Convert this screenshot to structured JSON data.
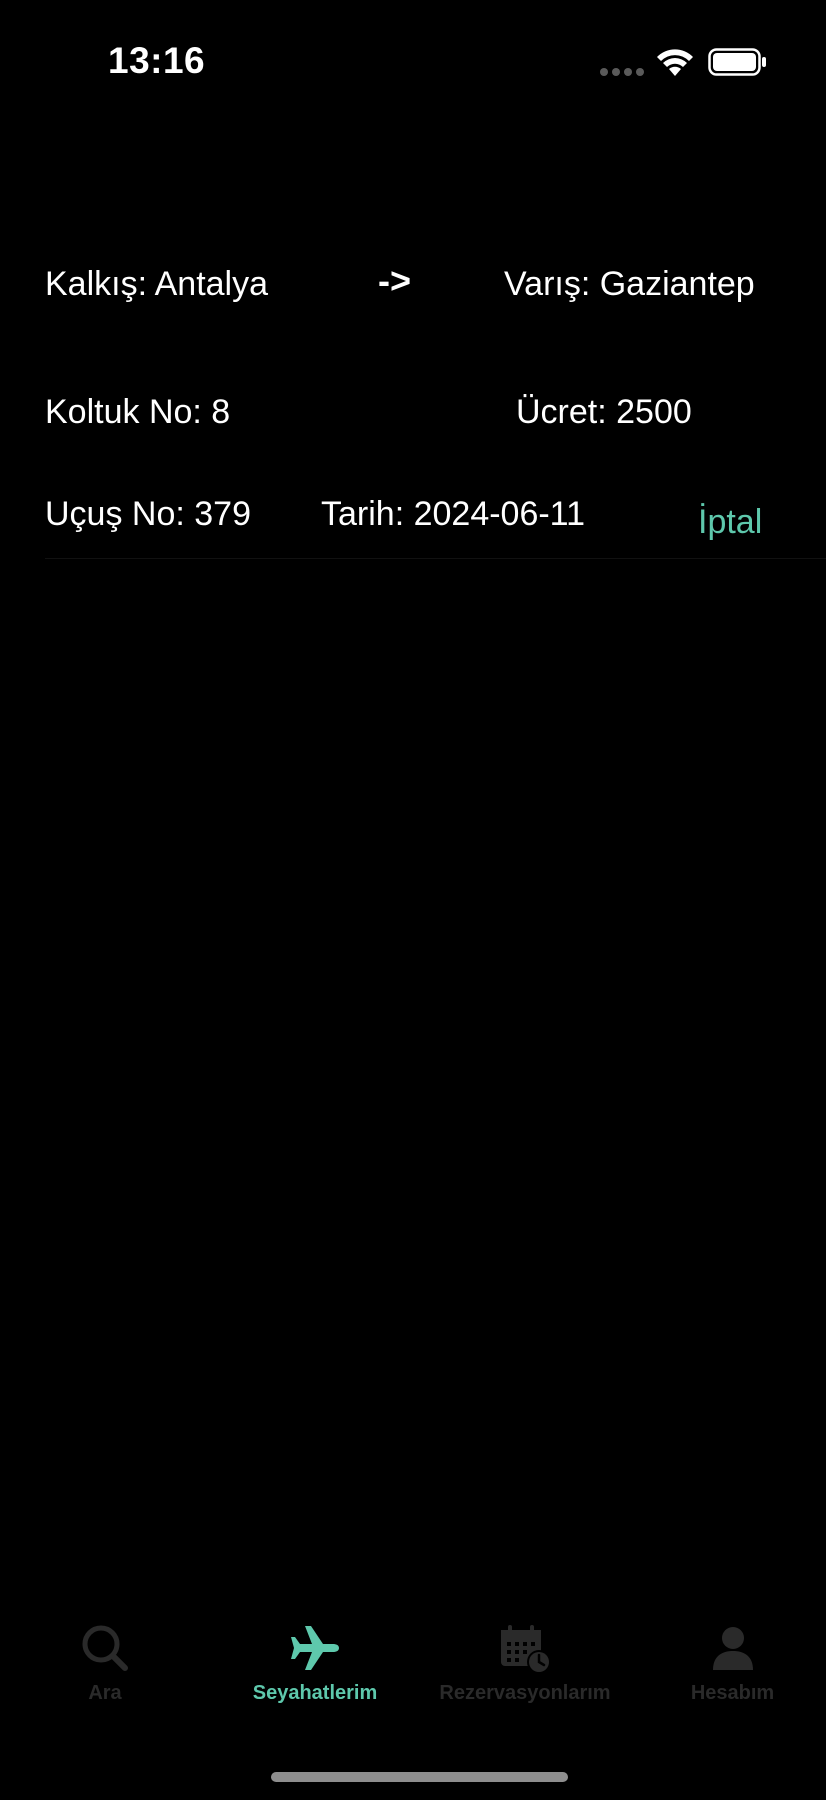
{
  "status_bar": {
    "time": "13:16"
  },
  "trip": {
    "departure": "Kalkış: Antalya",
    "arrow": "->",
    "arrival": "Varış: Gaziantep",
    "seat": "Koltuk No: 8",
    "price": "Ücret: 2500",
    "flight_no": "Uçuş No: 379",
    "date": "Tarih: 2024-06-11",
    "cancel_label": "İptal"
  },
  "tab_bar": {
    "tabs": [
      {
        "label": "Ara",
        "icon": "search-icon",
        "active": false
      },
      {
        "label": "Seyahatlerim",
        "icon": "airplane-icon",
        "active": true
      },
      {
        "label": "Rezervasyonlarım",
        "icon": "calendar-clock-icon",
        "active": false
      },
      {
        "label": "Hesabım",
        "icon": "person-icon",
        "active": false
      }
    ]
  },
  "colors": {
    "background": "#000000",
    "accent": "#5ec8ac",
    "inactive_tab": "#2a2a2a",
    "text": "#ffffff"
  }
}
